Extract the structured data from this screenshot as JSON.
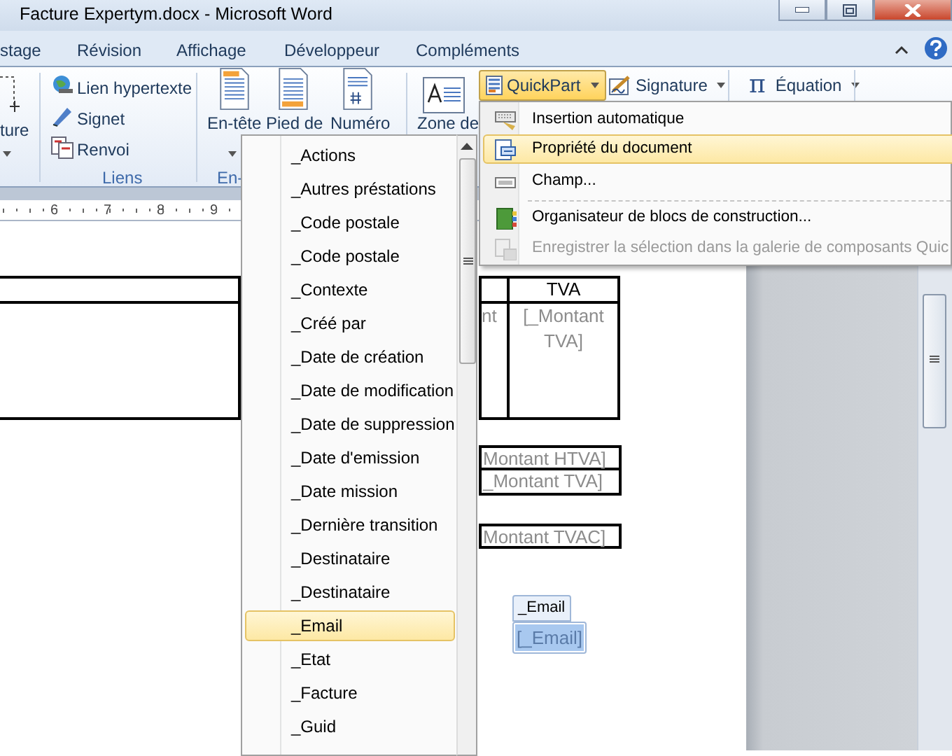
{
  "window": {
    "title": "Facture Expertym.docx  -  Microsoft Word"
  },
  "ribbon_tabs": [
    {
      "label": "stage",
      "selected": false
    },
    {
      "label": "Révision",
      "selected": false
    },
    {
      "label": "Affichage",
      "selected": false
    },
    {
      "label": "Développeur",
      "selected": false
    },
    {
      "label": "Compléments",
      "selected": false
    }
  ],
  "ribbon": {
    "partial_button": "ture",
    "links_group": {
      "label": "Liens",
      "items": [
        "Lien hypertexte",
        "Signet",
        "Renvoi"
      ]
    },
    "header_group": {
      "label": "En-",
      "buttons": [
        "En-tête",
        "Pied de",
        "Numéro"
      ]
    },
    "text_box_button": "Zone de",
    "insert_buttons": [
      {
        "label": "QuickPart",
        "pressed": true,
        "kind": "quickpart"
      },
      {
        "label": "Signature",
        "pressed": false,
        "kind": "signature"
      },
      {
        "label": "Équation",
        "pressed": false,
        "kind": "equation",
        "symbol": "π"
      }
    ]
  },
  "ruler": [
    "6",
    "7",
    "8",
    "9"
  ],
  "document": {
    "tva_table": {
      "header": "TVA",
      "cells": [
        "nt",
        "[_Montant TVA]"
      ]
    },
    "totals": [
      "Montant HTVA]",
      "_Montant TVA]",
      "Montant TVAC]"
    ],
    "content_control": {
      "tag": "_Email",
      "value": "[_Email]",
      "selected": true
    }
  },
  "quickpart_menu": [
    {
      "label": "Insertion automatique",
      "kind": "autotext",
      "selected": false,
      "disabled": false
    },
    {
      "label": "Propriété du document",
      "kind": "property",
      "selected": true,
      "disabled": false
    },
    {
      "label": "Champ...",
      "kind": "field",
      "selected": false,
      "disabled": false
    },
    {
      "label": "Organisateur de blocs de construction...",
      "kind": "organizer",
      "selected": false,
      "disabled": false
    },
    {
      "label": "Enregistrer la sélection dans la galerie de composants Quic",
      "kind": "save",
      "selected": false,
      "disabled": true
    }
  ],
  "property_menu": [
    {
      "label": "_Actions",
      "selected": false
    },
    {
      "label": "_Autres préstations",
      "selected": false
    },
    {
      "label": "_Code postale",
      "selected": false
    },
    {
      "label": "_Code postale",
      "selected": false
    },
    {
      "label": "_Contexte",
      "selected": false
    },
    {
      "label": "_Créé par",
      "selected": false
    },
    {
      "label": "_Date de création",
      "selected": false
    },
    {
      "label": "_Date de modification",
      "selected": false
    },
    {
      "label": "_Date de suppression",
      "selected": false
    },
    {
      "label": "_Date d'emission",
      "selected": false
    },
    {
      "label": "_Date mission",
      "selected": false
    },
    {
      "label": "_Dernière transition",
      "selected": false
    },
    {
      "label": "_Destinataire",
      "selected": false
    },
    {
      "label": "_Destinataire",
      "selected": false
    },
    {
      "label": "_Email",
      "selected": true
    },
    {
      "label": "_Etat",
      "selected": false
    },
    {
      "label": "_Facture",
      "selected": false
    },
    {
      "label": "_Guid",
      "selected": false
    }
  ]
}
